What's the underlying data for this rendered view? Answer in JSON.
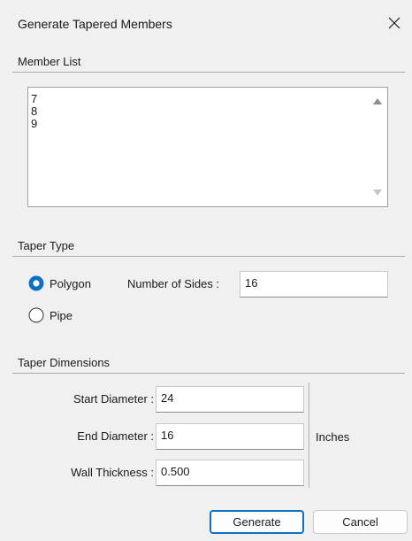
{
  "window": {
    "title": "Generate Tapered Members"
  },
  "member_list": {
    "heading": "Member List",
    "items": [
      "7",
      "8",
      "9"
    ]
  },
  "taper_type": {
    "heading": "Taper Type",
    "options": [
      {
        "label": "Polygon",
        "selected": true
      },
      {
        "label": "Pipe",
        "selected": false
      }
    ],
    "sides_label": "Number of Sides :",
    "sides_value": "16"
  },
  "taper_dimensions": {
    "heading": "Taper Dimensions",
    "start_label": "Start Diameter :",
    "start_value": "24",
    "end_label": "End Diameter :",
    "end_value": "16",
    "wall_label": "Wall Thickness :",
    "wall_value": "0.500",
    "units": "Inches"
  },
  "buttons": {
    "generate": "Generate",
    "cancel": "Cancel"
  },
  "colors": {
    "accent": "#0f6fc5",
    "background": "#f0f0f0"
  }
}
